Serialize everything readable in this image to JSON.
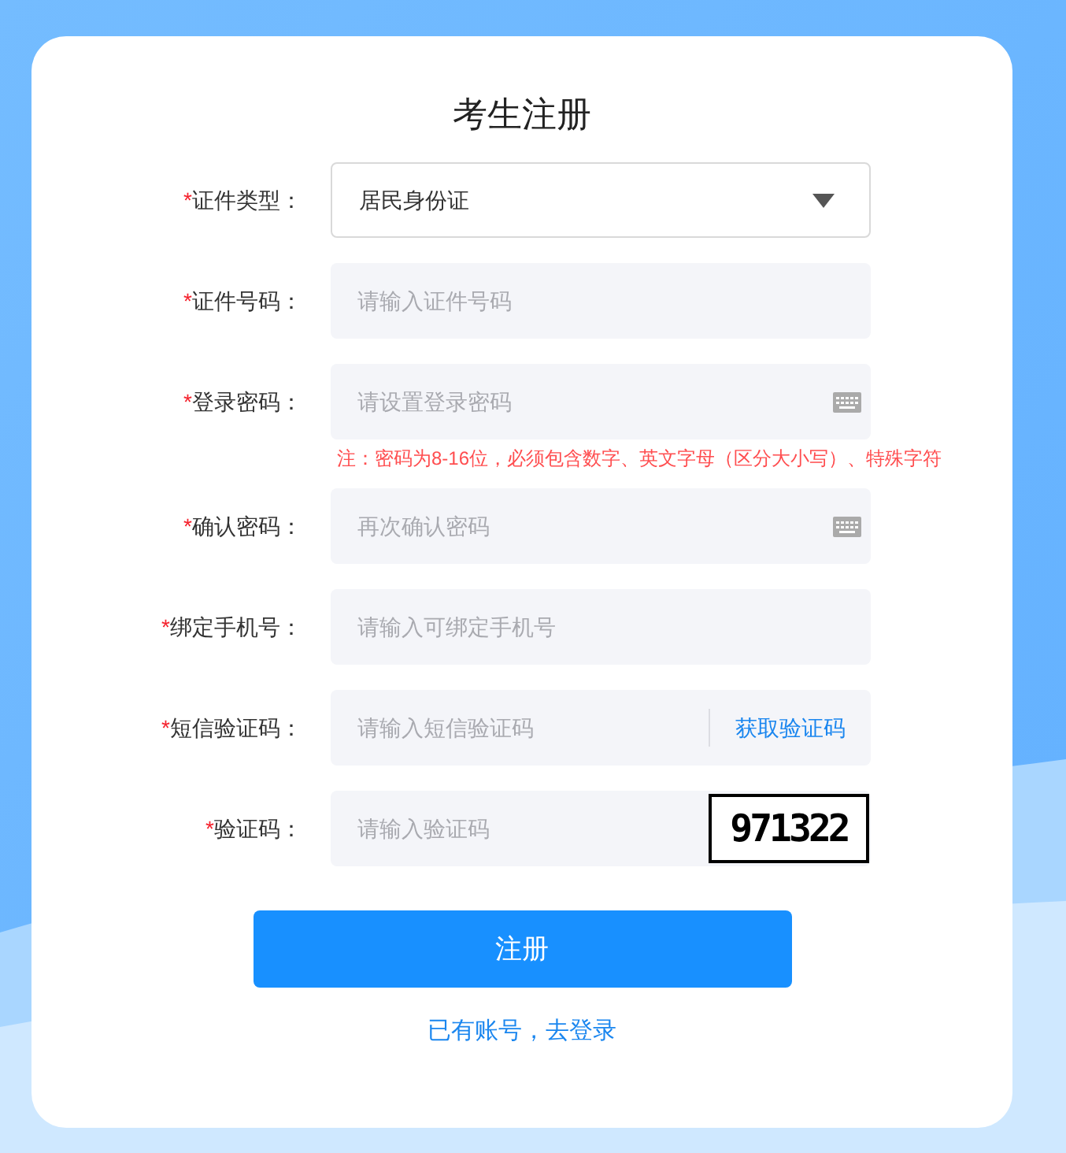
{
  "title": "考生注册",
  "fields": [
    {
      "kind": "select",
      "required_mark": "*",
      "label": "证件类型：",
      "value": "居民身份证"
    },
    {
      "kind": "text",
      "required_mark": "*",
      "label": "证件号码：",
      "placeholder": "请输入证件号码"
    },
    {
      "kind": "password",
      "required_mark": "*",
      "label": "登录密码：",
      "placeholder": "请设置登录密码",
      "note": "注：密码为8-16位，必须包含数字、英文字母（区分大小写）、特殊字符"
    },
    {
      "kind": "password",
      "required_mark": "*",
      "label": "确认密码：",
      "placeholder": "再次确认密码"
    },
    {
      "kind": "text",
      "required_mark": "*",
      "label": "绑定手机号：",
      "placeholder": "请输入可绑定手机号"
    },
    {
      "kind": "sms",
      "required_mark": "*",
      "label": "短信验证码：",
      "placeholder": "请输入短信验证码",
      "action": "获取验证码"
    },
    {
      "kind": "captcha",
      "required_mark": "*",
      "label": "验证码：",
      "placeholder": "请输入验证码",
      "captcha_code": "971322"
    }
  ],
  "submit": "注册",
  "login_link": "已有账号，去登录"
}
